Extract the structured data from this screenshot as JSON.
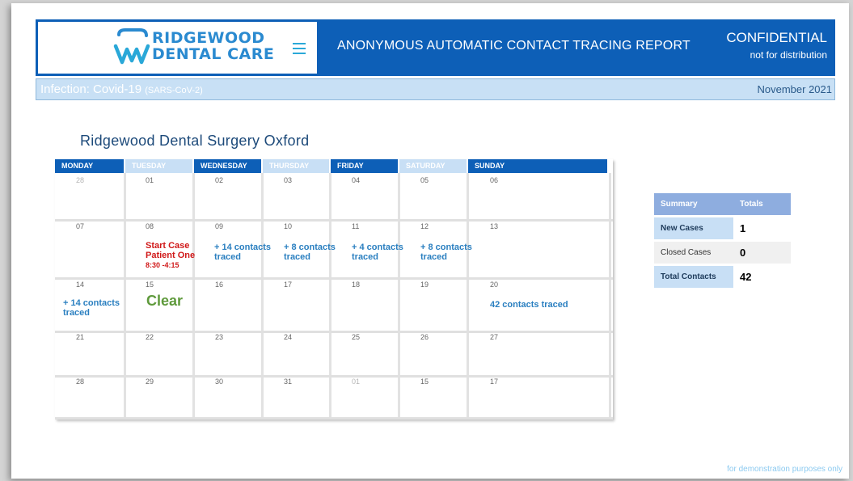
{
  "brand": {
    "line1": "RIDGEWOOD",
    "line2": "DENTAL CARE",
    "primary_color": "#0d5fb7",
    "accent_color": "#2a8ad0",
    "logo_icon": "tooth-icon"
  },
  "header": {
    "menu_icon": "hamburger-menu-icon",
    "title": "ANONYMOUS AUTOMATIC CONTACT TRACING REPORT",
    "confidential": "CONFIDENTIAL",
    "distribution": "not for distribution"
  },
  "infobar": {
    "infection": "Infection: Covid-19",
    "variant": "(SARS-CoV-2)",
    "date": "November 2021"
  },
  "surgery": "Ridgewood Dental Surgery Oxford",
  "calendar": {
    "days": [
      "MONDAY",
      "TUESDAY",
      "WEDNESDAY",
      "THURSDAY",
      "FRIDAY",
      "SATURDAY",
      "SUNDAY"
    ],
    "weeks": [
      [
        "28",
        "01",
        "02",
        "03",
        "04",
        "05",
        "06"
      ],
      [
        "07",
        "08",
        "09",
        "10",
        "11",
        "12",
        "13"
      ],
      [
        "14",
        "15",
        "16",
        "17",
        "18",
        "19",
        "20"
      ],
      [
        "21",
        "22",
        "23",
        "24",
        "25",
        "26",
        "27"
      ],
      [
        "28",
        "29",
        "30",
        "31",
        "01",
        "15",
        "17"
      ]
    ],
    "events": {
      "w2_tue_1": "Start Case",
      "w2_tue_2": "Patient One",
      "w2_tue_3": "8:30 -4:15",
      "w2_wed_1": "+ 14 contacts",
      "w2_wed_2": "traced",
      "w2_thu_1": "+ 8 contacts",
      "w2_thu_2": "traced",
      "w2_fri_1": "+ 4 contacts",
      "w2_fri_2": "traced",
      "w2_sat_1": "+ 8 contacts",
      "w2_sat_2": "traced",
      "w3_mon_1": "+ 14 contacts",
      "w3_mon_2": "traced",
      "w3_tue": "Clear",
      "w3_sun": "42 contacts traced"
    }
  },
  "summary": {
    "col1": "Summary",
    "col2": "Totals",
    "rows": [
      {
        "label": "New Cases",
        "value": "1"
      },
      {
        "label": "Closed Cases",
        "value": "0"
      },
      {
        "label": "Total Contacts",
        "value": "42"
      }
    ]
  },
  "footer": "for demonstration purposes only"
}
